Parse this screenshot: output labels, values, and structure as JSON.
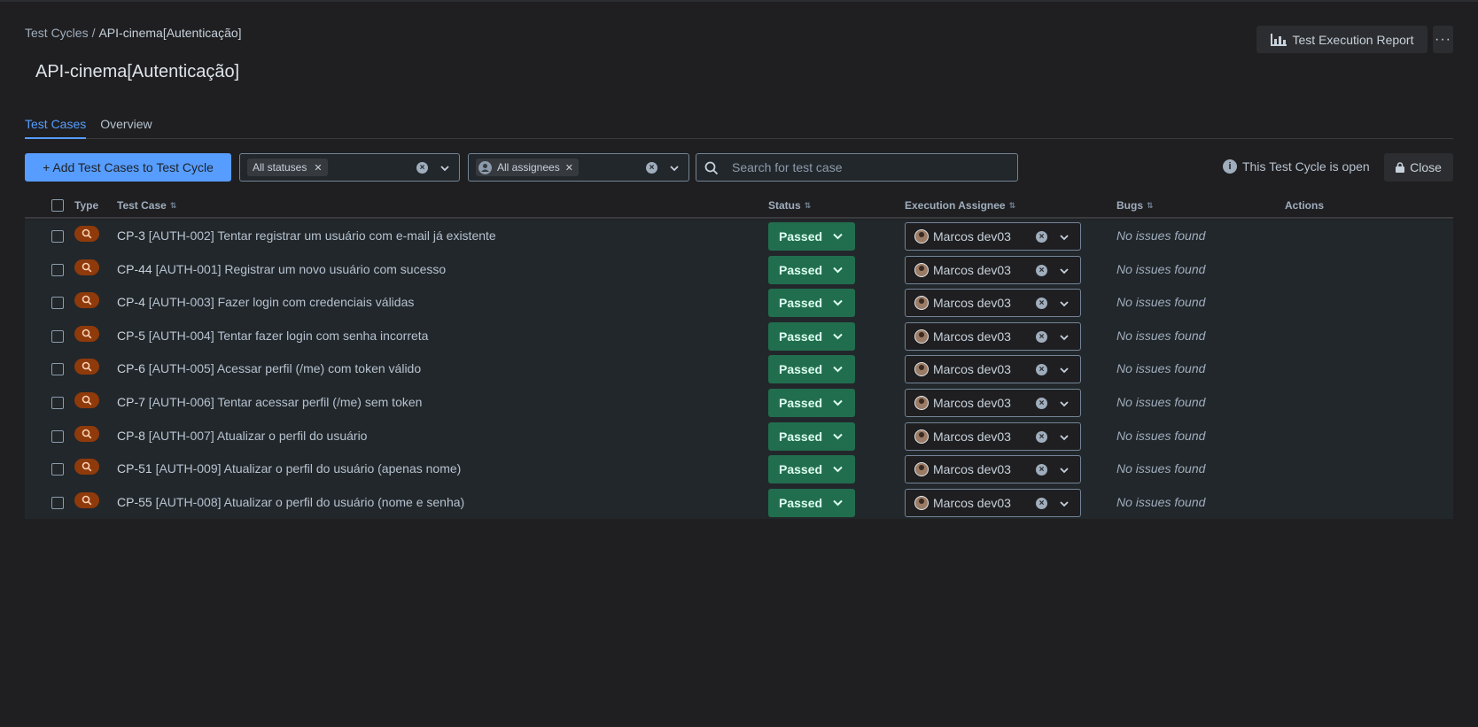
{
  "breadcrumb": {
    "parent": "Test Cycles",
    "separator": "/",
    "current": "API-cinema[Autenticação]"
  },
  "page": {
    "title": "API-cinema[Autenticação]"
  },
  "header": {
    "report_label": "Test Execution Report",
    "more_label": "···"
  },
  "tabs": [
    {
      "label": "Test Cases"
    },
    {
      "label": "Overview"
    }
  ],
  "toolbar": {
    "add_label": "+ Add Test Cases to Test Cycle",
    "status_filter": "All statuses",
    "assignee_filter": "All assignees",
    "search_placeholder": "Search for test case",
    "open_status": "This Test Cycle is open",
    "close_label": "Close"
  },
  "columns": {
    "type": "Type",
    "test_case": "Test Case",
    "status": "Status",
    "assignee": "Execution Assignee",
    "bugs": "Bugs",
    "actions": "Actions"
  },
  "rows": [
    {
      "key": "CP-3",
      "name": "[AUTH-002] Tentar registrar um usuário com e-mail já existente",
      "status": "Passed",
      "assignee": "Marcos dev03",
      "bugs": "No issues found"
    },
    {
      "key": "CP-44",
      "name": "[AUTH-001] Registrar um novo usuário com sucesso",
      "status": "Passed",
      "assignee": "Marcos dev03",
      "bugs": "No issues found"
    },
    {
      "key": "CP-4",
      "name": "[AUTH-003] Fazer login com credenciais válidas",
      "status": "Passed",
      "assignee": "Marcos dev03",
      "bugs": "No issues found"
    },
    {
      "key": "CP-5",
      "name": "[AUTH-004] Tentar fazer login com senha incorreta",
      "status": "Passed",
      "assignee": "Marcos dev03",
      "bugs": "No issues found"
    },
    {
      "key": "CP-6",
      "name": "[AUTH-005] Acessar perfil (/me) com token válido",
      "status": "Passed",
      "assignee": "Marcos dev03",
      "bugs": "No issues found"
    },
    {
      "key": "CP-7",
      "name": "[AUTH-006] Tentar acessar perfil (/me) sem token",
      "status": "Passed",
      "assignee": "Marcos dev03",
      "bugs": "No issues found"
    },
    {
      "key": "CP-8",
      "name": "[AUTH-007] Atualizar o perfil do usuário",
      "status": "Passed",
      "assignee": "Marcos dev03",
      "bugs": "No issues found"
    },
    {
      "key": "CP-51",
      "name": "[AUTH-009] Atualizar o perfil do usuário (apenas nome)",
      "status": "Passed",
      "assignee": "Marcos dev03",
      "bugs": "No issues found"
    },
    {
      "key": "CP-55",
      "name": "[AUTH-008] Atualizar o perfil do usuário (nome e senha)",
      "status": "Passed",
      "assignee": "Marcos dev03",
      "bugs": "No issues found"
    }
  ],
  "colors": {
    "accent": "#579dff",
    "passed": "#216e4e",
    "type_badge": "#8f3a0b",
    "background": "#1f1f21"
  },
  "icons": {
    "report": "bar-chart-icon",
    "type": "search-icon",
    "lock": "lock-icon",
    "info": "info-icon"
  }
}
